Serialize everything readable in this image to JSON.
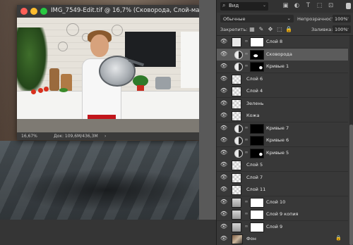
{
  "document": {
    "title": "IMG_7549-Edit.tif @ 16,7% (Сковорода, Слой-маска/16) *",
    "zoom": "16,67%",
    "doc_size": "Док: 109,6M/436,3M",
    "status_arrow": "›"
  },
  "layers_panel": {
    "search_label": "Вид",
    "search_icon": "⌕",
    "search_caret": "⌄",
    "filter_icons": [
      "▣",
      "◐",
      "T",
      "⬚",
      "⊡"
    ],
    "blend_mode": "Обычные",
    "blend_caret": "⌄",
    "opacity_label": "Непрозрачность:",
    "opacity_value": "100%",
    "lock_label": "Закрепить:",
    "lock_icons": [
      "▦",
      "✎",
      "✥",
      "⬚",
      "🔒"
    ],
    "fill_label": "Заливка:",
    "fill_value": "100%",
    "eye_glyph": "👁",
    "chain_glyph": "∞",
    "lock_badge": "🔒",
    "layers": [
      {
        "name": "Слой 8",
        "kind": "layer-mask",
        "thumb": "white",
        "mask": "white",
        "selected": false
      },
      {
        "name": "Сковорода",
        "kind": "adj-mask",
        "mask": "black-blob",
        "selected": true
      },
      {
        "name": "Кривые 1",
        "kind": "adj-mask",
        "mask": "black-dot",
        "selected": false
      },
      {
        "name": "Слой 6",
        "kind": "plain",
        "thumb": "checker",
        "selected": false
      },
      {
        "name": "Слой 4",
        "kind": "plain",
        "thumb": "checker",
        "selected": false
      },
      {
        "name": "Зелень",
        "kind": "plain",
        "thumb": "checker",
        "selected": false
      },
      {
        "name": "Кожа",
        "kind": "plain",
        "thumb": "checker",
        "selected": false
      },
      {
        "name": "Кривые 7",
        "kind": "adj-mask",
        "mask": "black",
        "selected": false
      },
      {
        "name": "Кривые 6",
        "kind": "adj-mask",
        "mask": "black",
        "selected": false
      },
      {
        "name": "Кривые 5",
        "kind": "adj-mask",
        "mask": "black-dot",
        "selected": false
      },
      {
        "name": "Слой 5",
        "kind": "plain",
        "thumb": "checker",
        "selected": false
      },
      {
        "name": "Слой 7",
        "kind": "plain",
        "thumb": "checker",
        "selected": false
      },
      {
        "name": "Слой 11",
        "kind": "plain",
        "thumb": "checker",
        "selected": false
      },
      {
        "name": "Слой 10",
        "kind": "layer-mask",
        "thumb": "img2",
        "mask": "white",
        "selected": false
      },
      {
        "name": "Слой 9 копия",
        "kind": "layer-mask",
        "thumb": "img2",
        "mask": "white",
        "selected": false
      },
      {
        "name": "Слой 9",
        "kind": "layer-mask",
        "thumb": "img2",
        "mask": "white",
        "selected": false
      },
      {
        "name": "Фон",
        "kind": "background",
        "thumb": "photo",
        "selected": false
      }
    ]
  }
}
